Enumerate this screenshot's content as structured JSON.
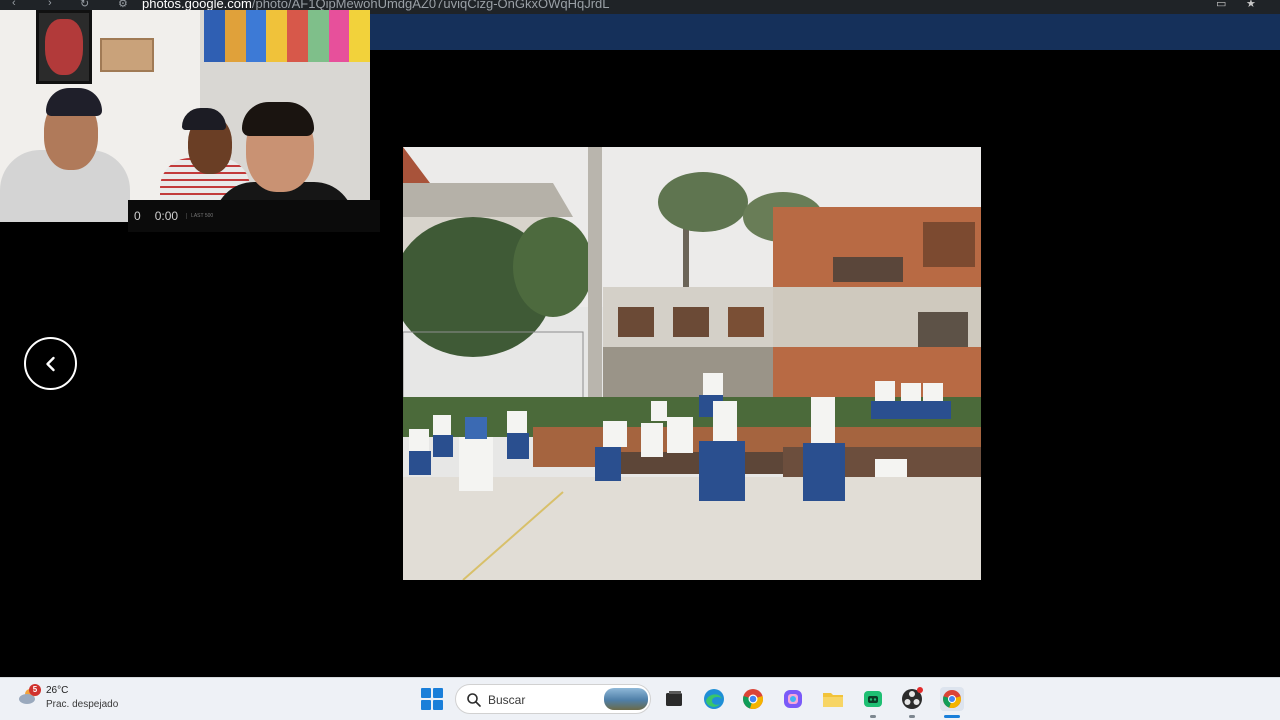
{
  "browser": {
    "url_host": "photos.google.com",
    "url_path": "/photo/AF1QipMewohUmdgAZ07uviqCizg-OnGkxOWqHqJrdL"
  },
  "webcam": {
    "counter": "0",
    "time": "0:00",
    "small_label": "LAST 500"
  },
  "viewer": {
    "back_icon": "chevron-left-icon"
  },
  "taskbar": {
    "weather": {
      "temperature": "26°C",
      "condition": "Prac. despejado",
      "badge": "5"
    },
    "search_placeholder": "Buscar",
    "apps": [
      "start",
      "search",
      "file-viewer",
      "edge",
      "chrome",
      "copilot",
      "file-explorer",
      "gadget",
      "obs",
      "chrome-active"
    ]
  },
  "colors": {
    "viewer_header": "#15305a",
    "accent": "#1a7fd9"
  }
}
